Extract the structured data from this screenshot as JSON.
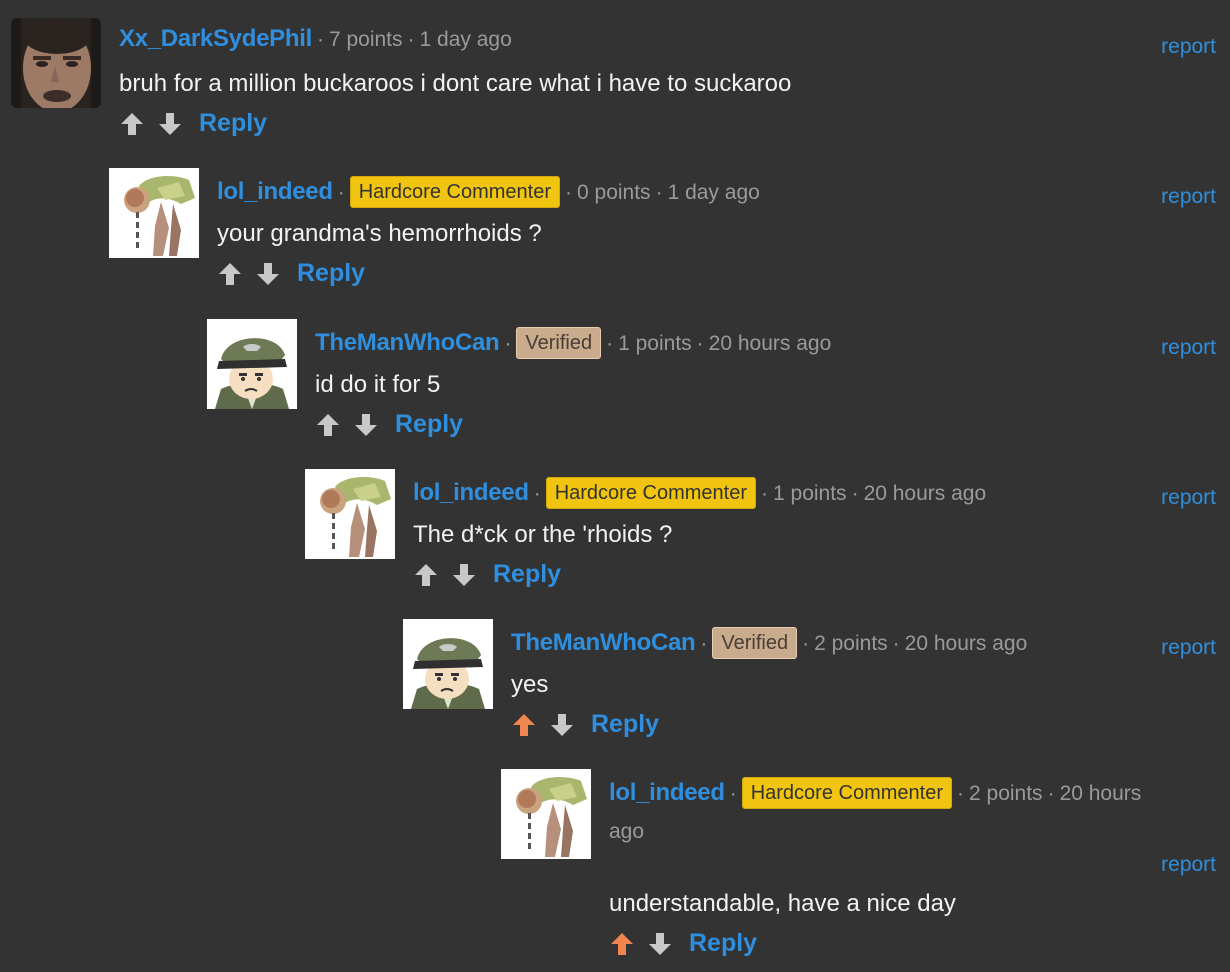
{
  "colors": {
    "background": "#333333",
    "link": "#2f8fde",
    "meta": "#9a9a9a",
    "text": "#f2f2f2",
    "hardcore_badge": "#f1c40f",
    "verified_badge": "#c9ab8e",
    "upvoted": "#f0864e",
    "vote_default": "#c8c8c8"
  },
  "comments": [
    {
      "avatar": "dsp-face-avatar",
      "username": "Xx_DarkSydePhil",
      "badge": "",
      "points": "7 points",
      "time": "1 day ago",
      "text": "bruh for a million buckaroos i dont care what i have to suckaroo",
      "upvoted": false,
      "reply_label": "Reply",
      "report_label": "report"
    },
    {
      "avatar": "bent-figure-avatar",
      "username": "lol_indeed",
      "badge": "Hardcore Commenter",
      "points": "0 points",
      "time": "1 day ago",
      "text": "your grandma's hemorrhoids ?",
      "upvoted": false,
      "reply_label": "Reply",
      "report_label": "report"
    },
    {
      "avatar": "officer-cartoon-avatar",
      "username": "TheManWhoCan",
      "badge": "Verified",
      "points": "1 points",
      "time": "20 hours ago",
      "text": "id do it for 5",
      "upvoted": false,
      "reply_label": "Reply",
      "report_label": "report"
    },
    {
      "avatar": "bent-figure-avatar",
      "username": "lol_indeed",
      "badge": "Hardcore Commenter",
      "points": "1 points",
      "time": "20 hours ago",
      "text": "The d*ck or the 'rhoids ?",
      "upvoted": false,
      "reply_label": "Reply",
      "report_label": "report"
    },
    {
      "avatar": "officer-cartoon-avatar",
      "username": "TheManWhoCan",
      "badge": "Verified",
      "points": "2 points",
      "time": "20 hours ago",
      "text": "yes",
      "upvoted": true,
      "reply_label": "Reply",
      "report_label": "report"
    },
    {
      "avatar": "bent-figure-avatar",
      "username": "lol_indeed",
      "badge": "Hardcore Commenter",
      "points": "2 points",
      "time_part1": "20 hours",
      "time_part2": "ago",
      "text": "understandable, have a nice day",
      "upvoted": true,
      "reply_label": "Reply",
      "report_label": "report"
    }
  ]
}
